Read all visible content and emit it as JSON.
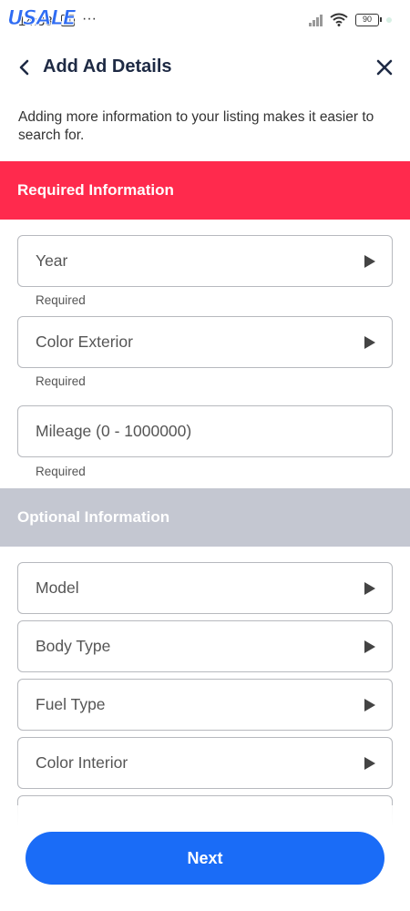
{
  "status_bar": {
    "watermark": "USALE",
    "time": "14:38",
    "calendar_day": "31",
    "more": "···",
    "battery": "90"
  },
  "header": {
    "title": "Add Ad Details"
  },
  "intro": "Adding more information to your listing makes it easier to search for.",
  "required_section": {
    "title": "Required Information",
    "fields": [
      {
        "label": "Year",
        "helper": "Required"
      },
      {
        "label": "Color Exterior",
        "helper": "Required"
      },
      {
        "label": "Mileage (0 - 1000000)",
        "helper": "Required"
      }
    ]
  },
  "optional_section": {
    "title": "Optional Information",
    "fields": [
      {
        "label": "Model"
      },
      {
        "label": "Body Type"
      },
      {
        "label": "Fuel Type"
      },
      {
        "label": "Color Interior"
      }
    ]
  },
  "footer": {
    "next_label": "Next"
  },
  "colors": {
    "required": "#ff2a4d",
    "optional": "#c4c7d1",
    "primary": "#1a6cf7"
  }
}
